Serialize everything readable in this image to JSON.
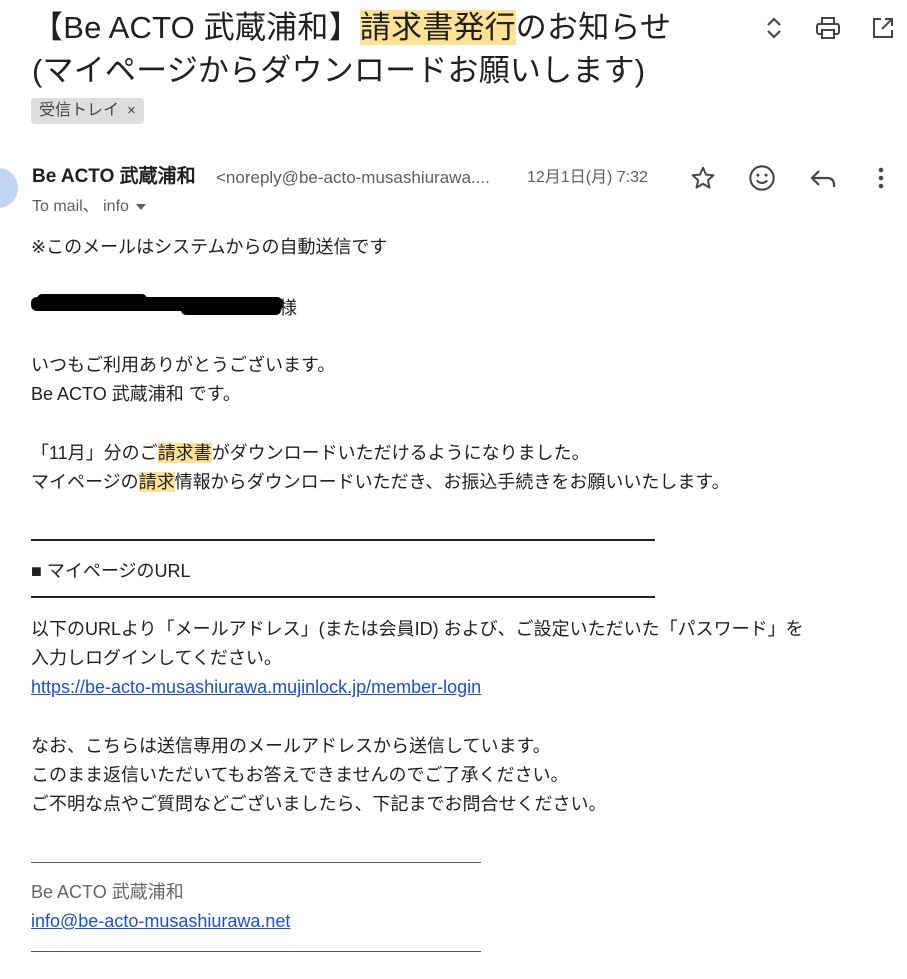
{
  "subject": {
    "prefix": "【Be ACTO 武蔵浦和】",
    "highlight": "請求書発行",
    "suffix": "のお知らせ",
    "line2": "(マイページからダウンロードお願いします)"
  },
  "label_chip": {
    "text": "受信トレイ",
    "remove": "×"
  },
  "sender": {
    "name": "Be ACTO 武蔵浦和",
    "email": "<noreply@be-acto-musashiurawa....",
    "date": "12月1日(月) 7:32",
    "recipients": "To mail、 info"
  },
  "body": {
    "line1": "※このメールはシステムからの自動送信です",
    "salutation_suffix": "様",
    "greeting1": "いつもご利用ありがとうございます。",
    "greeting2": "Be ACTO 武蔵浦和 です。",
    "p1_a": "「11月」分のご",
    "p1_hl": "請求書",
    "p1_b": "がダウンロードいただけるようになりました。",
    "p2_a": "マイページの",
    "p2_hl": "請求",
    "p2_b": "情報からダウンロードいただき、お振込手続きをお願いいたします。",
    "section_heading": "■ マイページのURL",
    "p3_line1": "以下のURLより「メールアドレス」(または会員ID) および、ご設定いただいた「パスワード」を",
    "p3_line2": "入力しログインしてください。",
    "login_url": "https://be-acto-musashiurawa.mujinlock.jp/member-login",
    "p4_line1": "なお、こちらは送信専用のメールアドレスから送信しています。",
    "p4_line2": "このまま返信いただいてもお答えできませんのでご了承ください。",
    "p4_line3": "ご不明な点やご質問などございましたら、下記までお問合せください。",
    "signature_name": "Be ACTO 武蔵浦和",
    "signature_email": "info@be-acto-musashiurawa.net"
  },
  "icons": {
    "expand": "unfold-icon",
    "print": "print-icon",
    "popout": "open-in-new-window-icon",
    "star": "star-icon",
    "emoji": "emoji-icon",
    "reply": "reply-icon",
    "more": "more-vert-icon",
    "dropdown": "chevron-down-icon"
  },
  "colors": {
    "highlight": "#fde293",
    "link": "#1a4fd6",
    "chip_bg": "#dddddd"
  }
}
